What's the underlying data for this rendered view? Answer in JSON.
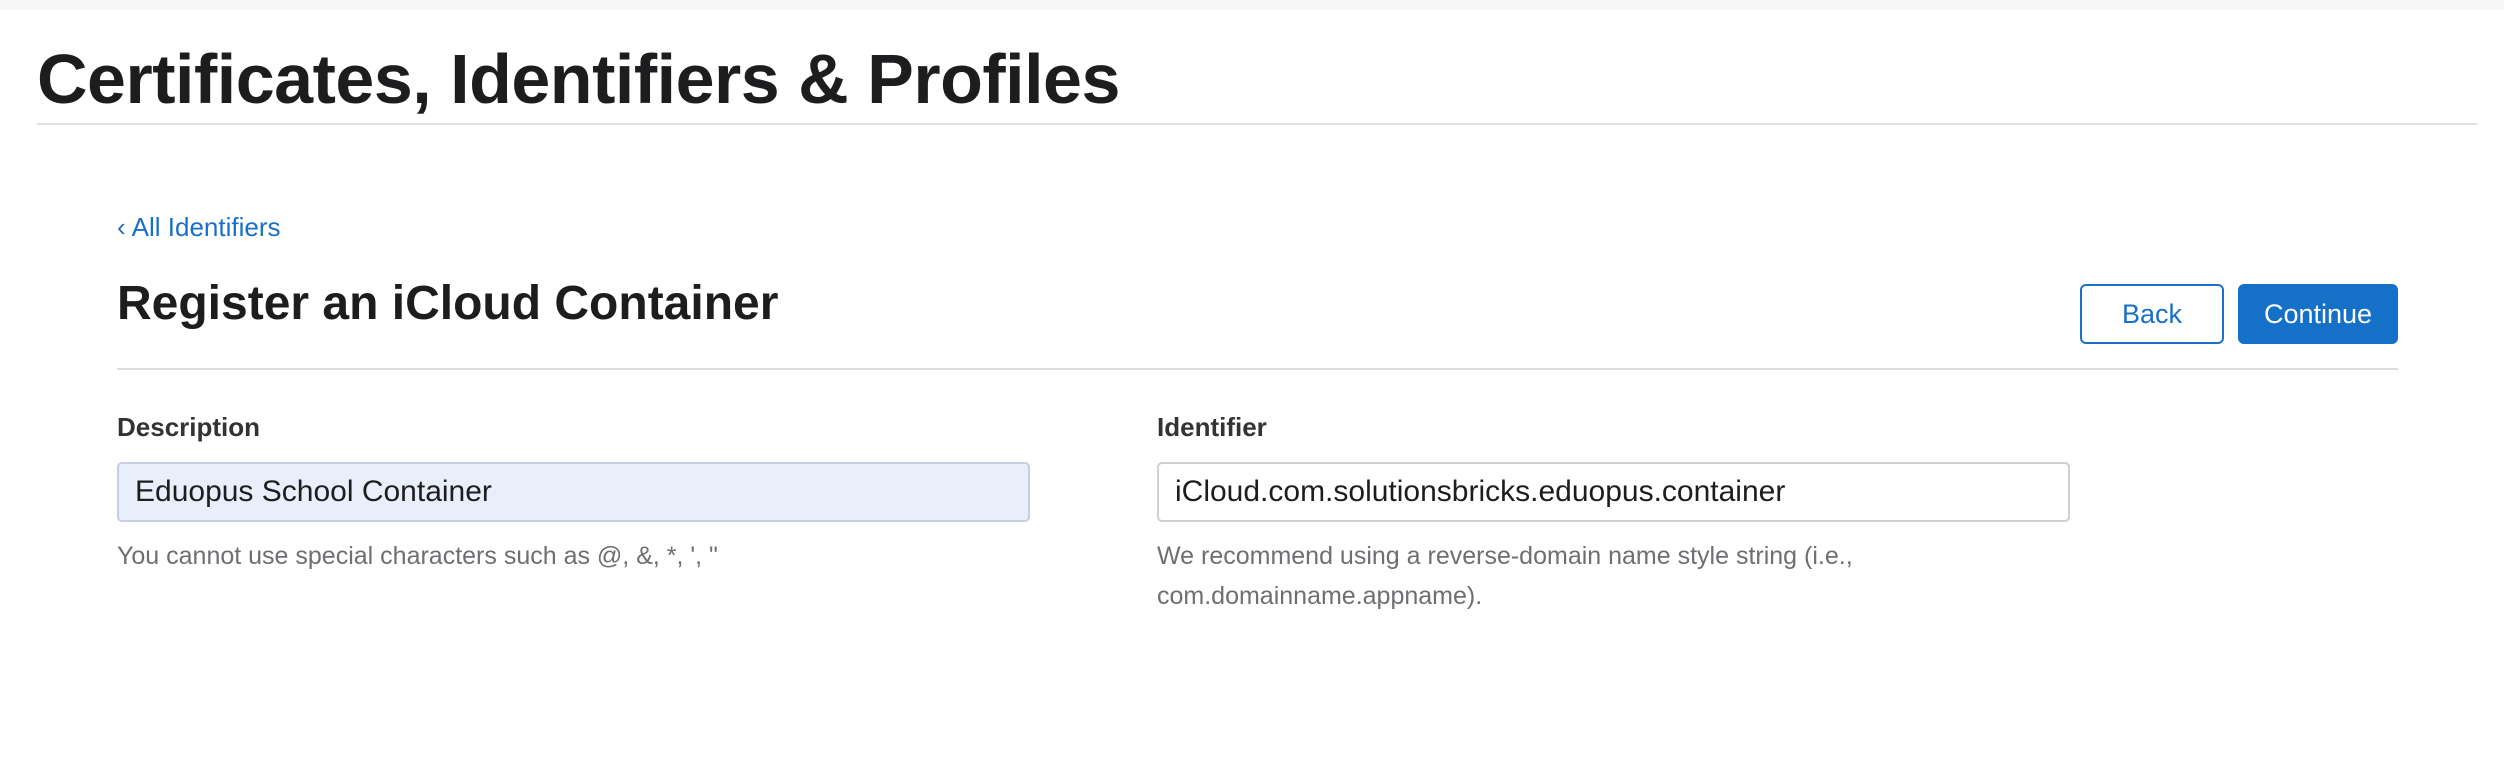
{
  "page": {
    "title": "Certificates, Identifiers & Profiles"
  },
  "breadcrumb": {
    "chevron": "‹",
    "label": "All Identifiers"
  },
  "section": {
    "title": "Register an iCloud Container"
  },
  "actions": {
    "back_label": "Back",
    "continue_label": "Continue"
  },
  "form": {
    "description": {
      "label": "Description",
      "value": "Eduopus School Container",
      "help": "You cannot use special characters such as @, &, *, ', \""
    },
    "identifier": {
      "label": "Identifier",
      "value": "iCloud.com.solutionsbricks.eduopus.container",
      "help": "We recommend using a reverse-domain name style string (i.e., com.domainname.appname)."
    }
  },
  "colors": {
    "accent": "#1570c8",
    "link": "#1a6fc9",
    "autofill_bg": "#e8effb",
    "help_text": "#6e6e73"
  }
}
